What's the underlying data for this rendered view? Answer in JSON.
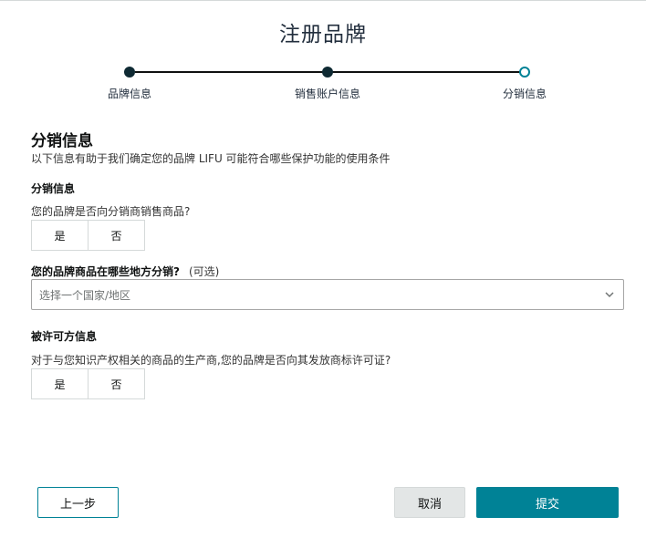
{
  "page": {
    "title": "注册品牌"
  },
  "stepper": {
    "steps": [
      {
        "label": "品牌信息",
        "state": "complete"
      },
      {
        "label": "销售账户信息",
        "state": "complete"
      },
      {
        "label": "分销信息",
        "state": "current"
      }
    ]
  },
  "distribution": {
    "title": "分销信息",
    "description": "以下信息有助于我们确定您的品牌 LIFU 可能符合哪些保护功能的使用条件",
    "subheading": "分销信息",
    "question": "您的品牌是否向分销商销售商品?",
    "yes_label": "是",
    "no_label": "否",
    "where_question": "您的品牌商品在哪些地方分销?",
    "where_optional": "(可选)",
    "country_placeholder": "选择一个国家/地区"
  },
  "licensing": {
    "subheading": "被许可方信息",
    "question": "对于与您知识产权相关的商品的生产商,您的品牌是否向其发放商标许可证?",
    "yes_label": "是",
    "no_label": "否"
  },
  "footer": {
    "back_label": "上一步",
    "cancel_label": "取消",
    "submit_label": "提交"
  },
  "colors": {
    "accent": "#008296",
    "step_complete": "#0f2a33",
    "cancel_bg": "#e3e6e6"
  }
}
